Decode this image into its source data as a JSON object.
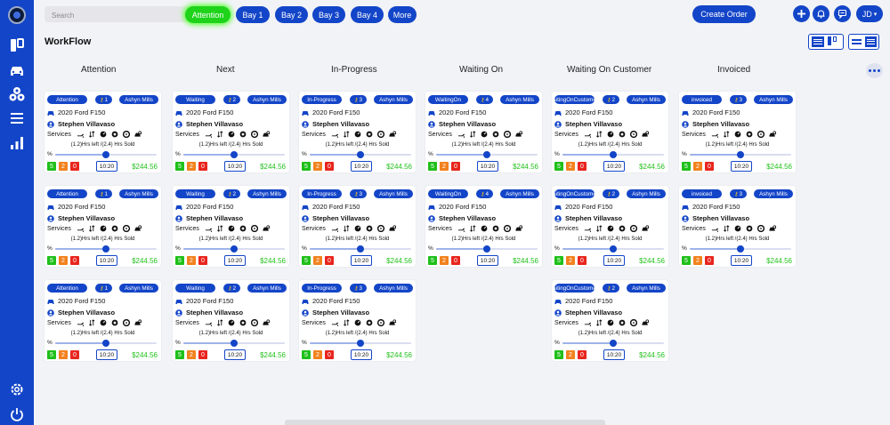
{
  "sidebar": {
    "items": [
      {
        "icon": "board-icon"
      },
      {
        "icon": "car-icon"
      },
      {
        "icon": "parts-icon"
      },
      {
        "icon": "list-icon"
      },
      {
        "icon": "report-icon"
      },
      {
        "icon": "gear-icon"
      },
      {
        "icon": "power-icon"
      }
    ]
  },
  "topbar": {
    "search_placeholder": "Search",
    "filters": [
      {
        "label": "Attention",
        "active": true
      },
      {
        "label": "Bay 1",
        "active": false
      },
      {
        "label": "Bay 2",
        "active": false
      },
      {
        "label": "Bay 3",
        "active": false
      },
      {
        "label": "Bay 4",
        "active": false
      },
      {
        "label": "More",
        "active": false
      }
    ],
    "create_order": "Create Order",
    "user_initials": "JD"
  },
  "page": {
    "title": "WorkFlow"
  },
  "columns": [
    {
      "title": "Attention"
    },
    {
      "title": "Next"
    },
    {
      "title": "In-Progress"
    },
    {
      "title": "Waiting On"
    },
    {
      "title": "Waiting On Customer"
    },
    {
      "title": "Invoiced"
    }
  ],
  "cards": [
    {
      "status": "Attention",
      "bay": "1",
      "location": "Ashyn Mills",
      "vehicle": "2020 Ford F150",
      "customer": "Stephen Villavaso",
      "services_label": "Services",
      "hours": "(1.2)Hrs left /(2.4) Hrs Sold",
      "progress_pct": 50,
      "counts": [
        "5",
        "2",
        "0"
      ],
      "time": "10:20",
      "price": "$244.56"
    },
    {
      "status": "Waiting",
      "bay": "2",
      "location": "Ashyn Mills",
      "vehicle": "2020 Ford F150",
      "customer": "Stephen Villavaso",
      "services_label": "Services",
      "hours": "(1.2)Hrs left /(2.4) Hrs Sold",
      "progress_pct": 50,
      "counts": [
        "5",
        "2",
        "0"
      ],
      "time": "10:20",
      "price": "$244.56"
    },
    {
      "status": "In-Progress",
      "bay": "3",
      "location": "Ashyn Mills",
      "vehicle": "2020 Ford F150",
      "customer": "Stephen Villavaso",
      "services_label": "Services",
      "hours": "(1.2)Hrs left /(2.4) Hrs Sold",
      "progress_pct": 50,
      "counts": [
        "5",
        "2",
        "0"
      ],
      "time": "10:20",
      "price": "$244.56"
    },
    {
      "status": "WaitingOn",
      "bay": "4",
      "location": "Ashyn Mills",
      "vehicle": "2020 Ford F150",
      "customer": "Stephen Villavaso",
      "services_label": "Services",
      "hours": "(1.2)Hrs left /(2.4) Hrs Sold",
      "progress_pct": 50,
      "counts": [
        "5",
        "2",
        "0"
      ],
      "time": "10:20",
      "price": "$244.56"
    },
    {
      "status": "aitingOnCustome",
      "bay": "2",
      "location": "Ashyn Mills",
      "vehicle": "2020 Ford F150",
      "customer": "Stephen Villavaso",
      "services_label": "Services",
      "hours": "(1.2)Hrs left /(2.4) Hrs Sold",
      "progress_pct": 50,
      "counts": [
        "5",
        "2",
        "0"
      ],
      "time": "10:20",
      "price": "$244.56"
    },
    {
      "status": "invoiced",
      "bay": "3",
      "location": "Ashyn Mills",
      "vehicle": "2020 Ford F150",
      "customer": "Stephen Villavaso",
      "services_label": "Services",
      "hours": "(1.2)Hrs left /(2.4) Hrs Sold",
      "progress_pct": 50,
      "counts": [
        "5",
        "2",
        "0"
      ],
      "time": "10:20",
      "price": "$244.56"
    },
    {
      "status": "Attention",
      "bay": "1",
      "location": "Ashyn Mills",
      "vehicle": "2020 Ford F150",
      "customer": "Stephen Villavaso",
      "services_label": "Services",
      "hours": "(1.2)Hrs left /(2.4) Hrs Sold",
      "progress_pct": 50,
      "counts": [
        "5",
        "2",
        "0"
      ],
      "time": "10:20",
      "price": "$244.56"
    },
    {
      "status": "Waiting",
      "bay": "2",
      "location": "Ashyn Mills",
      "vehicle": "2020 Ford F150",
      "customer": "Stephen Villavaso",
      "services_label": "Services",
      "hours": "(1.2)Hrs left /(2.4) Hrs Sold",
      "progress_pct": 50,
      "counts": [
        "5",
        "2",
        "0"
      ],
      "time": "10:20",
      "price": "$244.56"
    },
    {
      "status": "In-Progress",
      "bay": "3",
      "location": "Ashyn Mills",
      "vehicle": "2020 Ford F150",
      "customer": "Stephen Villavaso",
      "services_label": "Services",
      "hours": "(1.2)Hrs left /(2.4) Hrs Sold",
      "progress_pct": 50,
      "counts": [
        "5",
        "2",
        "0"
      ],
      "time": "10:20",
      "price": "$244.56"
    },
    {
      "status": "WaitingOn",
      "bay": "4",
      "location": "Ashyn Mills",
      "vehicle": "2020 Ford F150",
      "customer": "Stephen Villavaso",
      "services_label": "Services",
      "hours": "(1.2)Hrs left /(2.4) Hrs Sold",
      "progress_pct": 50,
      "counts": [
        "5",
        "2",
        "0"
      ],
      "time": "10:20",
      "price": "$244.56"
    },
    {
      "status": "aitingOnCustome",
      "bay": "2",
      "location": "Ashyn Mills",
      "vehicle": "2020 Ford F150",
      "customer": "Stephen Villavaso",
      "services_label": "Services",
      "hours": "(1.2)Hrs left /(2.4) Hrs Sold",
      "progress_pct": 50,
      "counts": [
        "5",
        "2",
        "0"
      ],
      "time": "10:20",
      "price": "$244.56"
    },
    {
      "status": "invoiced",
      "bay": "3",
      "location": "Ashyn Mills",
      "vehicle": "2020 Ford F150",
      "customer": "Stephen Villavaso",
      "services_label": "Services",
      "hours": "(1.2)Hrs left /(2.4) Hrs Sold",
      "progress_pct": 50,
      "counts": [
        "5",
        "2",
        "0"
      ],
      "time": "10:20",
      "price": "$244.56"
    },
    {
      "status": "Attention",
      "bay": "1",
      "location": "Ashyn Mills",
      "vehicle": "2020 Ford F150",
      "customer": "Stephen Villavaso",
      "services_label": "Services",
      "hours": "(1.2)Hrs left /(2.4) Hrs Sold",
      "progress_pct": 50,
      "counts": [
        "5",
        "2",
        "0"
      ],
      "time": "10:20",
      "price": "$244.56"
    },
    {
      "status": "Waiting",
      "bay": "2",
      "location": "Ashyn Mills",
      "vehicle": "2020 Ford F150",
      "customer": "Stephen Villavaso",
      "services_label": "Services",
      "hours": "(1.2)Hrs left /(2.4) Hrs Sold",
      "progress_pct": 50,
      "counts": [
        "5",
        "2",
        "0"
      ],
      "time": "10:20",
      "price": "$244.56"
    },
    {
      "status": "In-Progress",
      "bay": "3",
      "location": "Ashyn Mills",
      "vehicle": "2020 Ford F150",
      "customer": "Stephen Villavaso",
      "services_label": "Services",
      "hours": "(1.2)Hrs left /(2.4) Hrs Sold",
      "progress_pct": 50,
      "counts": [
        "5",
        "2",
        "0"
      ],
      "time": "10:20",
      "price": "$244.56"
    },
    {
      "status": "aitingOnCustome",
      "bay": "2",
      "location": "Ashyn Mills",
      "vehicle": "2020 Ford F150",
      "customer": "Stephen Villavaso",
      "services_label": "Services",
      "hours": "(1.2)Hrs left /(2.4) Hrs Sold",
      "progress_pct": 50,
      "counts": [
        "5",
        "2",
        "0"
      ],
      "time": "10:20",
      "price": "$244.56"
    }
  ],
  "colors": {
    "primary": "#1345c8",
    "active_filter": "#1fd31b",
    "count_green": "#1fc01a",
    "count_orange": "#f2821e",
    "count_red": "#e8261e",
    "price": "#24c21d"
  }
}
